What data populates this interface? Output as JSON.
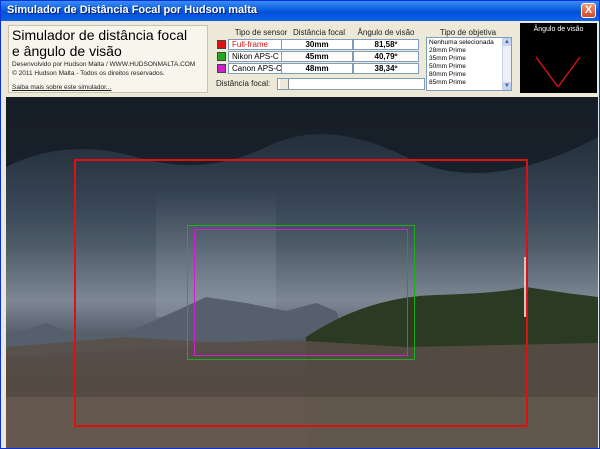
{
  "window": {
    "title": "Simulador de Distância Focal por Hudson malta",
    "close_symbol": "X"
  },
  "info": {
    "title_line1": "Simulador de distância focal",
    "title_line2": "e ângulo de visão",
    "developer": "Desenvolvido por Hudson Malta / WWW.HUDSONMALTA.COM",
    "copyright": "© 2011 Hudson Malta - Todos os direitos reservados.",
    "link": "Saiba mais sobre este simulador..."
  },
  "headers": {
    "sensor": "Tipo de sensor",
    "focal": "Distância focal",
    "angle": "Ângulo de visão",
    "lens": "Tipo de objetiva"
  },
  "sensors": [
    {
      "label": "Full-frame",
      "focal": "30mm",
      "angle": "81,58º",
      "color": "#dd1111"
    },
    {
      "label": "Nikon APS-C",
      "focal": "45mm",
      "angle": "40,79º",
      "color": "#22aa22"
    },
    {
      "label": "Canon APS-C",
      "focal": "48mm",
      "angle": "38,34º",
      "color": "#cc22cc"
    }
  ],
  "lens_options": [
    "Nenhuma selecionada",
    "28mm Prime",
    "35mm Prime",
    "50mm Prime",
    "80mm Prime",
    "85mm Prime"
  ],
  "slider": {
    "label": "Distância focal:"
  },
  "angle_panel": {
    "title": "Ângulo de visão"
  }
}
